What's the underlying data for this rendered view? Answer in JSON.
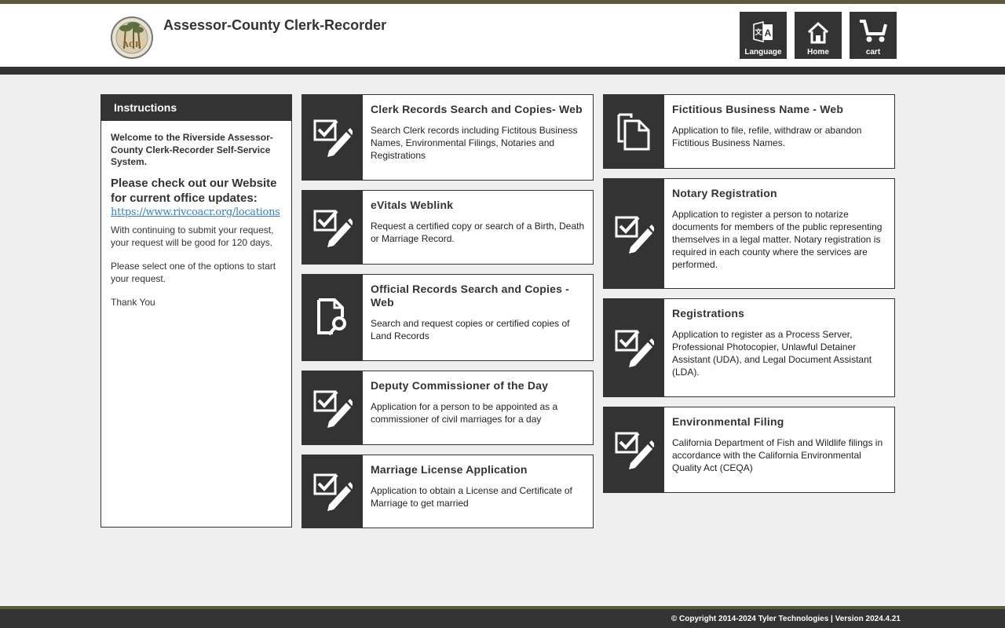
{
  "header": {
    "title": "Assessor-County Clerk-Recorder",
    "logo_text": "ACR",
    "nav": [
      {
        "label": "Language",
        "icon": "language-icon"
      },
      {
        "label": "Home",
        "icon": "home-icon"
      },
      {
        "label": "cart",
        "icon": "cart-icon"
      }
    ]
  },
  "instructions": {
    "title": "Instructions",
    "welcome": "Welcome to the Riverside Assessor-County Clerk-Recorder Self-Service System.",
    "check": "Please check out our Website for current office updates:",
    "link": "https://www.rivcoacr.org/locations",
    "p1": "With continuing to submit your request, your request will be good for 120 days.",
    "p2": "Please select one of the options to start your request.",
    "p3": "Thank You"
  },
  "cards": [
    {
      "title": "Clerk Records Search and Copies- Web",
      "desc": "Search Clerk records including Fictitous Business Names, Environmental Filings, Notaries and Registrations",
      "icon": "checkbox-pencil-icon"
    },
    {
      "title": "eVitals Weblink",
      "desc": "Request a certified copy or search of a Birth, Death or Marriage Record.",
      "icon": "checkbox-pencil-icon"
    },
    {
      "title": "Official Records Search and Copies - Web",
      "desc": "Search and request copies or certified copies of Land Records",
      "icon": "document-search-icon"
    },
    {
      "title": "Deputy Commissioner of the Day",
      "desc": "Application for a person to be appointed as a commissioner of civil marriages for a day",
      "icon": "checkbox-pencil-icon"
    },
    {
      "title": "Marriage License Application",
      "desc": "Application to obtain a License and Certificate of Marriage to get married",
      "icon": "checkbox-pencil-icon"
    },
    {
      "title": "Fictitious Business Name - Web",
      "desc": "Application to file, refile, withdraw or abandon Fictitious Business Names.",
      "icon": "copy-documents-icon"
    },
    {
      "title": "Notary Registration",
      "desc": "Application to register a person to notarize documents for members of the public representing themselves in a legal matter. Notary registration is required in each county where the services are performed.",
      "icon": "checkbox-pencil-icon"
    },
    {
      "title": "Registrations",
      "desc": "Application to register as a Process Server, Professional Photocopier, Unlawful Detainer Assistant (UDA), and Legal Document Assistant (LDA).",
      "icon": "checkbox-pencil-icon"
    },
    {
      "title": "Environmental Filing",
      "desc": "California Department of Fish and Wildlife filings in accordance with the California Environmental Quality Act (CEQA)",
      "icon": "checkbox-pencil-icon"
    }
  ],
  "footer": {
    "copyright": "© Copyright 2014-2024 Tyler Technologies | Version 2024.4.21"
  }
}
